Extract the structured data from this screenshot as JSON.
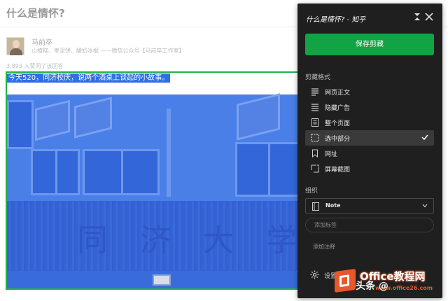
{
  "question": {
    "title": "什么是情怀?"
  },
  "author": {
    "name": "马前卒",
    "bio": "山楂糕、枣泥饼、酸奶冰棍 ——微信公众号【马前卒工作室】"
  },
  "answer": {
    "agree_text": "3,893 人赞同了该回答",
    "selected_text": "今天520，同济校庆，说两个酒桌上谈起的小故事。",
    "photo_sign_chars": [
      "同",
      "济",
      "大",
      "学"
    ]
  },
  "clipper": {
    "title": "什么是情怀? - 知乎",
    "save_label": "保存剪藏",
    "format_heading": "剪藏格式",
    "formats": [
      {
        "label": "网页正文",
        "icon": "article-icon",
        "selected": false
      },
      {
        "label": "隐藏广告",
        "icon": "hide-ads-icon",
        "selected": false
      },
      {
        "label": "整个页面",
        "icon": "full-page-icon",
        "selected": false
      },
      {
        "label": "选中部分",
        "icon": "selection-icon",
        "selected": true
      },
      {
        "label": "网址",
        "icon": "bookmark-icon",
        "selected": false
      },
      {
        "label": "屏幕截图",
        "icon": "screenshot-icon",
        "selected": false
      }
    ],
    "organize_heading": "组织",
    "notebook": "Note",
    "tag_placeholder": "添加标签",
    "add_note_label": "添加注释",
    "settings_label": "设置"
  },
  "watermark": {
    "toutiao": "头条 @",
    "brand": "Office教程网",
    "url": "www.office26.com"
  },
  "colors": {
    "accent_green": "#12a444",
    "selection_border": "#23b14d",
    "selection_fill": "#3b70e3",
    "panel_bg": "#1f1f1f",
    "brand_orange": "#e8572a"
  }
}
